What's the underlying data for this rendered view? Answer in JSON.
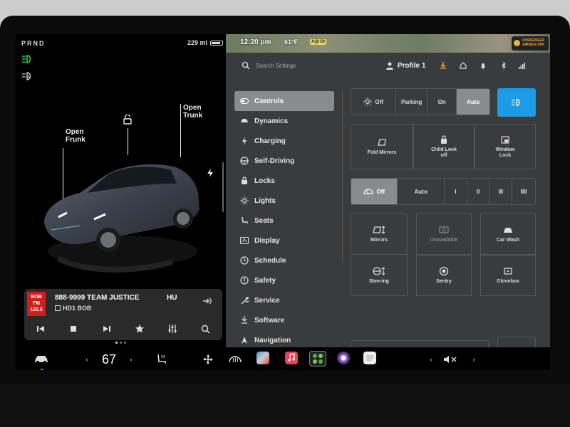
{
  "status": {
    "gear": "PRND",
    "range": "229 mi",
    "time": "12:20 pm",
    "temp": "61°F",
    "aqi": "AQI 50",
    "airbag_line1": "PASSENGER",
    "airbag_line2": "AIRBAG OFF"
  },
  "car": {
    "frunk_label": "Open\nFrunk",
    "trunk_label": "Open\nTrunk"
  },
  "media": {
    "logo_text": "BOB FM 103.5",
    "title": "888-9999 TEAM JUSTICE",
    "title_extra": "HU",
    "station": "HD1 BOB"
  },
  "header": {
    "search_placeholder": "Search Settings",
    "profile_label": "Profile 1"
  },
  "menu": [
    {
      "label": "Controls",
      "icon": "toggle-icon",
      "active": true
    },
    {
      "label": "Dynamics",
      "icon": "car-icon"
    },
    {
      "label": "Charging",
      "icon": "bolt-icon"
    },
    {
      "label": "Self-Driving",
      "icon": "steering-icon"
    },
    {
      "label": "Locks",
      "icon": "lock-icon"
    },
    {
      "label": "Lights",
      "icon": "sun-icon"
    },
    {
      "label": "Seats",
      "icon": "seat-icon"
    },
    {
      "label": "Display",
      "icon": "display-icon"
    },
    {
      "label": "Schedule",
      "icon": "clock-icon"
    },
    {
      "label": "Safety",
      "icon": "alert-icon"
    },
    {
      "label": "Service",
      "icon": "wrench-icon"
    },
    {
      "label": "Software",
      "icon": "download-icon"
    },
    {
      "label": "Navigation",
      "icon": "navigation-icon"
    }
  ],
  "controls": {
    "lights_seg": [
      "Off",
      "Parking",
      "On",
      "Auto"
    ],
    "lights_selected": "Auto",
    "fold_mirrors": "Fold Mirrors",
    "child_lock": "Child Lock",
    "child_lock_state": "off",
    "window_lock_1": "Window",
    "window_lock_2": "Lock",
    "wiper_seg": [
      "Off",
      "Auto",
      "I",
      "II",
      "III",
      "IIII"
    ],
    "wiper_selected": "Off",
    "mirrors": "Mirrors",
    "unavailable": "Unavailable",
    "car_wash": "Car Wash",
    "steering": "Steering",
    "sentry": "Sentry",
    "glovebox": "Glovebox",
    "brightness_auto": "Auto",
    "accent_color": "#1e9be6"
  },
  "bottombar": {
    "temp": "67",
    "left_chevron": "‹",
    "right_chevron": "›",
    "vol_left": "‹",
    "vol_right": "›"
  }
}
